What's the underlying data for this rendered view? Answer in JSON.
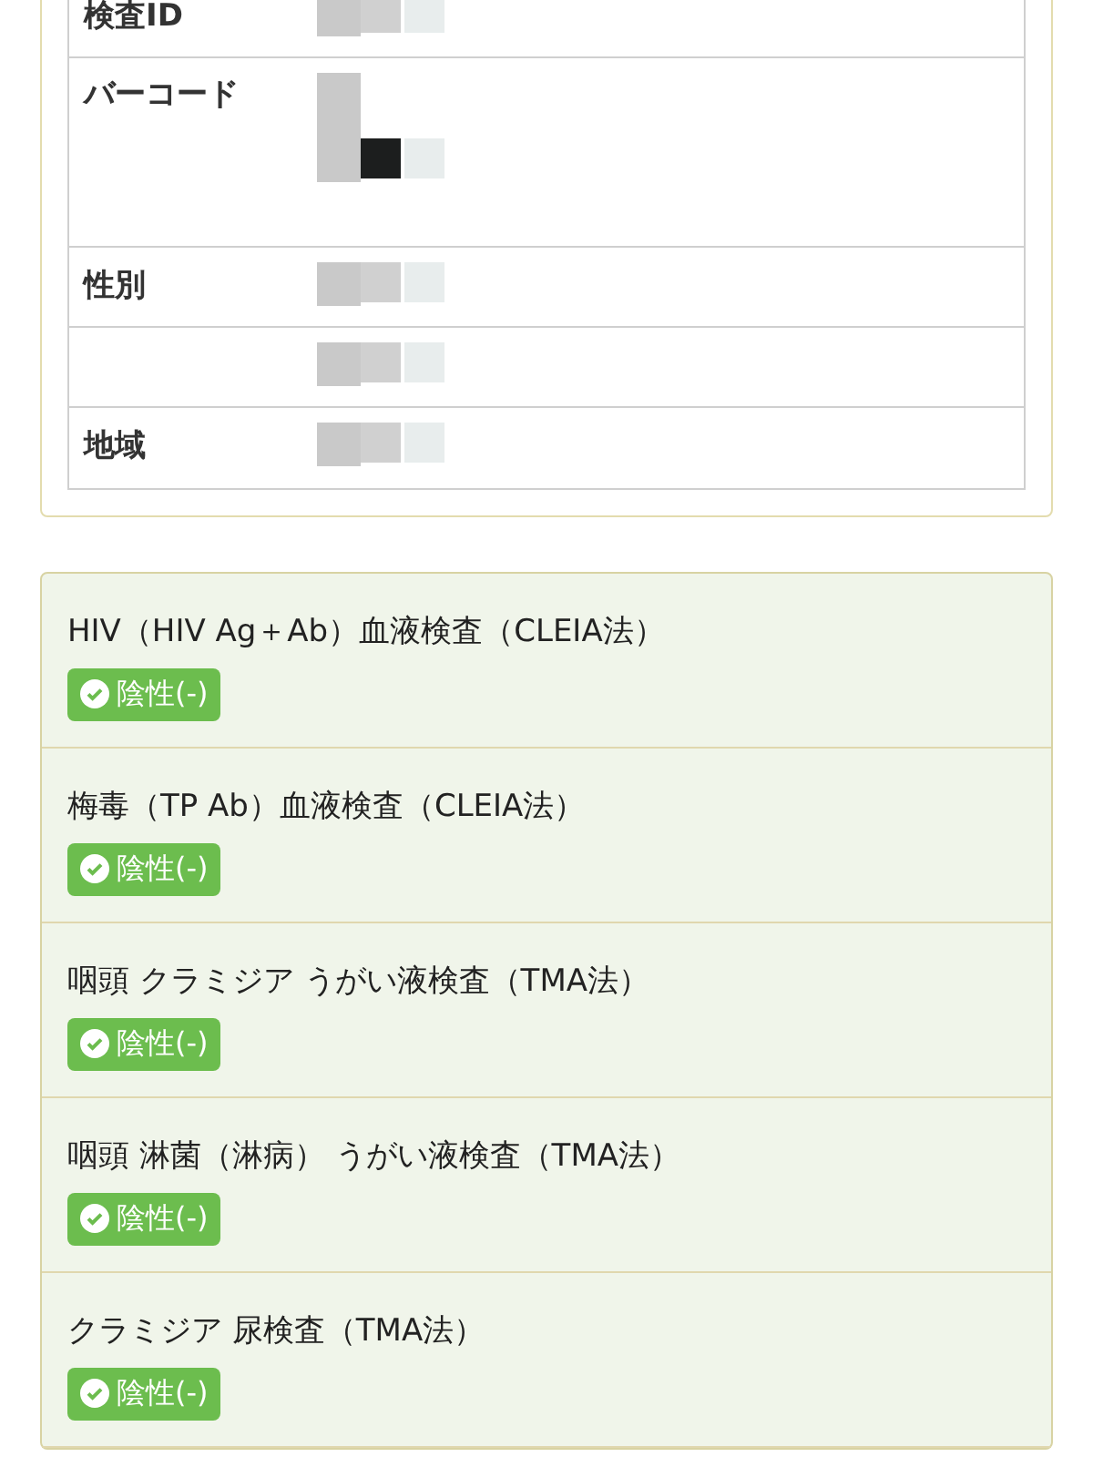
{
  "info_table": [
    {
      "label": "検査ID",
      "kind": "text"
    },
    {
      "label": "バーコード",
      "kind": "barcode"
    },
    {
      "label": "性別",
      "kind": "text"
    },
    {
      "kind": "text"
    },
    {
      "label": "地域",
      "kind": "text"
    }
  ],
  "results": [
    {
      "test": "HIV（HIV Ag＋Ab）血液検査（CLEIA法）",
      "result": "陰性(-)",
      "kind": "negative"
    },
    {
      "test": "梅毒（TP Ab）血液検査（CLEIA法）",
      "result": "陰性(-)",
      "kind": "negative"
    },
    {
      "test": "咽頭 クラミジア うがい液検査（TMA法）",
      "result": "陰性(-)",
      "kind": "negative"
    },
    {
      "test": "咽頭 淋菌（淋病） うがい液検査（TMA法）",
      "result": "陰性(-)",
      "kind": "negative"
    },
    {
      "test": "クラミジア 尿検査（TMA法）",
      "result": "陰性(-)",
      "kind": "negative"
    }
  ]
}
